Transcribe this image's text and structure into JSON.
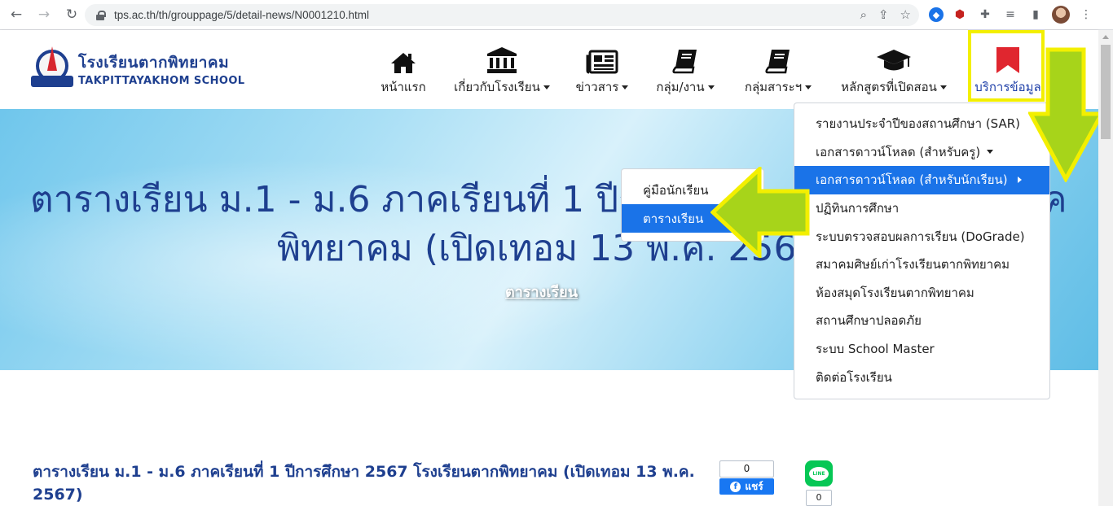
{
  "browser": {
    "url": "tps.ac.th/th/grouppage/5/detail-news/N0001210.html",
    "back_icon": "←",
    "forward_icon": "→",
    "reload_icon": "↻"
  },
  "site": {
    "name_th": "โรงเรียนตากพิทยาคม",
    "name_en": "TAKPITTAYAKHOM SCHOOL"
  },
  "nav": [
    {
      "label": "หน้าแรก",
      "icon": "home-icon"
    },
    {
      "label": "เกี่ยวกับโรงเรียน",
      "icon": "institution-icon"
    },
    {
      "label": "ข่าวสาร",
      "icon": "newspaper-icon"
    },
    {
      "label": "กลุ่ม/งาน",
      "icon": "book-icon"
    },
    {
      "label": "กลุ่มสาระฯ",
      "icon": "book-icon"
    },
    {
      "label": "หลักสูตรที่เปิดสอน",
      "icon": "graduation-cap-icon"
    },
    {
      "label": "บริการข้อมูล",
      "icon": "bookmark-icon"
    }
  ],
  "hero": {
    "title_line1": "ตารางเรียน ม.1 - ม.6 ภาคเรียนที่ 1 ปีก",
    "title_line1_right": "ค",
    "title_line2": "พิทยาคม (เปิดเทอม 13 พ.ค. 2567",
    "category": "ตารางเรียน"
  },
  "dropdown": {
    "items": [
      "รายงานประจำปีของสถานศึกษา (SAR)",
      "เอกสารดาวน์โหลด (สำหรับครู)",
      "เอกสารดาวน์โหลด (สำหรับนักเรียน)",
      "ปฏิทินการศึกษา",
      "ระบบตรวจสอบผลการเรียน (DoGrade)",
      "สมาคมศิษย์เก่าโรงเรียนตากพิทยาคม",
      "ห้องสมุดโรงเรียนตากพิทยาคม",
      "สถานศึกษาปลอดภัย",
      "ระบบ School Master",
      "ติดต่อโรงเรียน"
    ]
  },
  "submenu": {
    "items": [
      "คู่มือนักเรียน",
      "ตารางเรียน"
    ]
  },
  "article": {
    "title": "ตารางเรียน ม.1 - ม.6 ภาคเรียนที่ 1 ปีการศึกษา 2567 โรงเรียนตากพิทยาคม (เปิดเทอม 13 พ.ค. 2567)",
    "fb_count": "0",
    "fb_share_label": "แชร์",
    "line_label": "LINE",
    "line_count": "0"
  },
  "colors": {
    "brand_blue": "#1e3f8f",
    "menu_active": "#1a73e8",
    "highlight_yellow": "#f3ef00",
    "arrow_green": "#a7d41a"
  }
}
